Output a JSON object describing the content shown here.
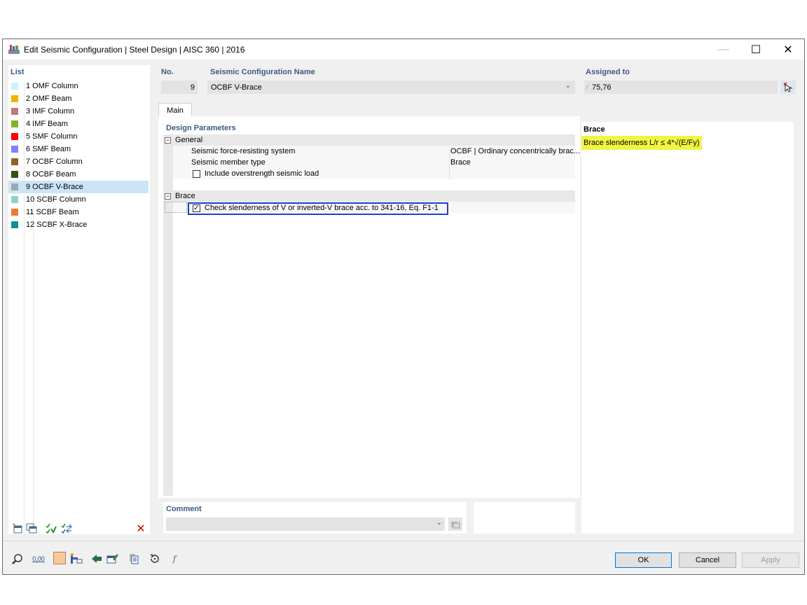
{
  "window": {
    "title": "Edit Seismic Configuration | Steel Design | AISC 360 | 2016",
    "minimize": "—",
    "maximize": "☐",
    "close": "✕"
  },
  "list": {
    "header": "List",
    "items": [
      {
        "label": "1 OMF Column",
        "color": "#ccf2ff"
      },
      {
        "label": "2 OMF Beam",
        "color": "#f0b400"
      },
      {
        "label": "3 IMF Column",
        "color": "#c07878"
      },
      {
        "label": "4 IMF Beam",
        "color": "#80b428"
      },
      {
        "label": "5 SMF Column",
        "color": "#ff0000"
      },
      {
        "label": "6 SMF Beam",
        "color": "#8080ff"
      },
      {
        "label": "7 OCBF Column",
        "color": "#8c6428"
      },
      {
        "label": "8 OCBF Beam",
        "color": "#3c5010"
      },
      {
        "label": "9 OCBF V-Brace",
        "color": "#a0a8b0"
      },
      {
        "label": "10 SCBF Column",
        "color": "#90d0d0"
      },
      {
        "label": "11 SCBF Beam",
        "color": "#f07830"
      },
      {
        "label": "12 SCBF X-Brace",
        "color": "#109090"
      }
    ],
    "selected_index": 8
  },
  "no": {
    "header": "No.",
    "value": "9"
  },
  "name": {
    "header": "Seismic Configuration Name",
    "value": "OCBF V-Brace"
  },
  "assigned": {
    "header": "Assigned to",
    "value": "75,76"
  },
  "tabs": [
    {
      "label": "Main"
    }
  ],
  "design": {
    "header": "Design Parameters",
    "general_label": "General",
    "system_label": "Seismic force-resisting system",
    "system_value": "OCBF | Ordinary concentrically brac...",
    "member_type_label": "Seismic member type",
    "member_type_value": "Brace",
    "overstrength_label": "Include overstrength seismic load",
    "brace_label": "Brace",
    "slenderness_check_label": "Check slenderness of V or inverted-V brace acc. to 341-16, Eq. F1-1",
    "minus": "⊟"
  },
  "info": {
    "header": "Brace",
    "formula": "Brace slenderness L/r ≤ 4*√(E/Fy)"
  },
  "comment": {
    "header": "Comment",
    "value": ""
  },
  "buttons": {
    "ok": "OK",
    "cancel": "Cancel",
    "apply": "Apply"
  },
  "bottom_toolbar": {
    "units_label": "0,00"
  },
  "colors": {
    "accent": "#3d5a80",
    "highlight": "#f2f542",
    "selection": "#cce4f7",
    "focus_border": "#1f3fcf"
  }
}
